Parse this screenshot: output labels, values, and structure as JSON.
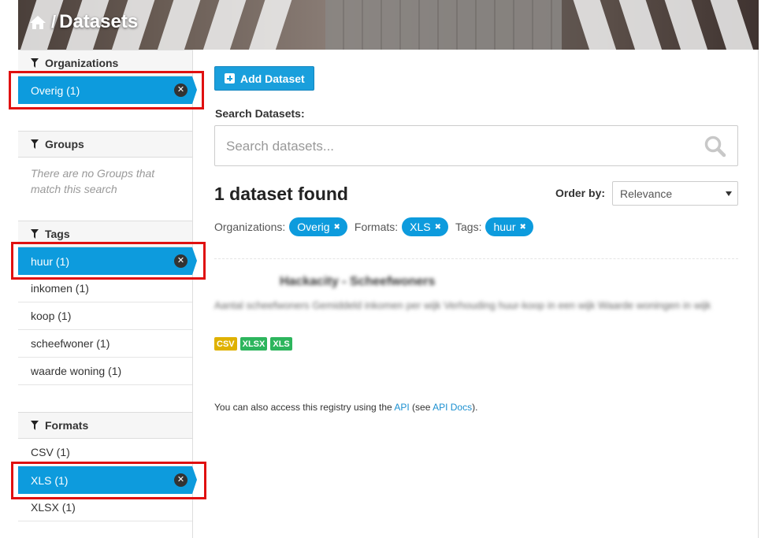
{
  "header": {
    "title": "Datasets"
  },
  "sidebar": {
    "organizations": {
      "title": "Organizations",
      "items": [
        {
          "label": "Overig (1)",
          "active": true
        }
      ]
    },
    "groups": {
      "title": "Groups",
      "empty_text": "There are no Groups that match this search"
    },
    "tags": {
      "title": "Tags",
      "items": [
        {
          "label": "huur (1)",
          "active": true
        },
        {
          "label": "inkomen (1)",
          "active": false
        },
        {
          "label": "koop (1)",
          "active": false
        },
        {
          "label": "scheefwoner (1)",
          "active": false
        },
        {
          "label": "waarde woning (1)",
          "active": false
        }
      ]
    },
    "formats": {
      "title": "Formats",
      "items": [
        {
          "label": "CSV (1)",
          "active": false
        },
        {
          "label": "XLS (1)",
          "active": true
        },
        {
          "label": "XLSX (1)",
          "active": false
        }
      ]
    }
  },
  "main": {
    "add_button": "Add Dataset",
    "search_label": "Search Datasets:",
    "search_placeholder": "Search datasets...",
    "result_count": "1 dataset found",
    "order_label": "Order by:",
    "order_value": "Relevance",
    "active_filters": [
      {
        "label": "Organizations:",
        "value": "Overig"
      },
      {
        "label": "Formats:",
        "value": "XLS"
      },
      {
        "label": "Tags:",
        "value": "huur"
      }
    ],
    "result": {
      "title": "Hackacity - Scheefwoners",
      "description": "Aantal scheefwoners Gemiddeld inkomen per wijk Verhouding huur-koop in een wijk Waarde woningen in wijk",
      "formats": [
        {
          "label": "CSV",
          "color": "#dfb100"
        },
        {
          "label": "XLSX",
          "color": "#2db55d"
        },
        {
          "label": "XLS",
          "color": "#2db55d"
        }
      ]
    },
    "api_note": {
      "prefix": "You can also access this registry using the ",
      "api_link": "API",
      "middle": " (see ",
      "docs_link": "API Docs",
      "suffix": ")."
    }
  },
  "colors": {
    "accent": "#0d9bdd",
    "highlight": "#e01010"
  }
}
